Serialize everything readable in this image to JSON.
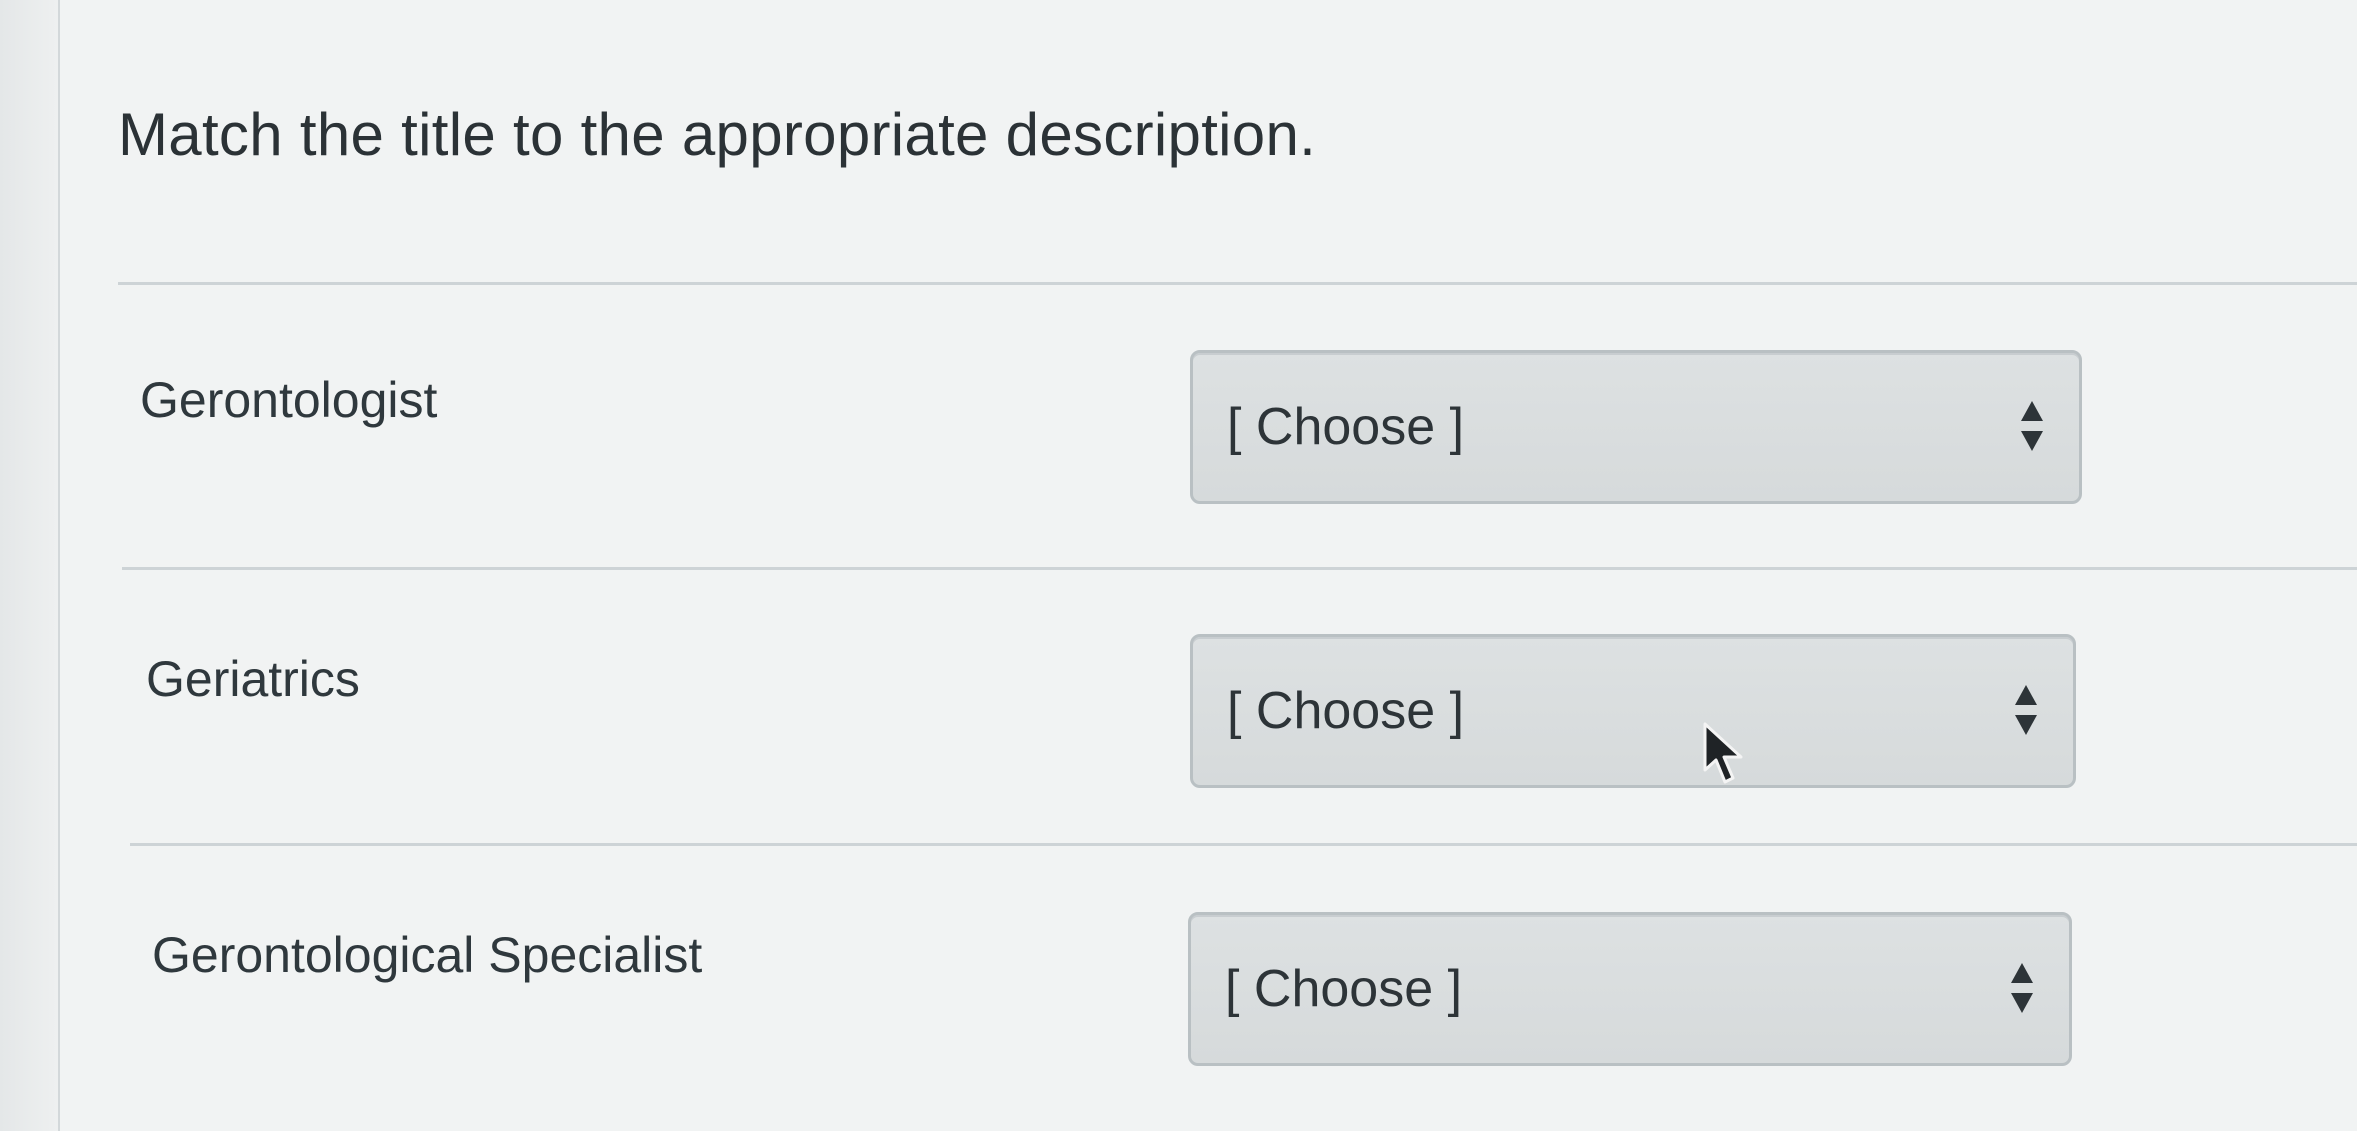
{
  "question": {
    "prompt": "Match the title to the appropriate description."
  },
  "answers": [
    {
      "term": "Gerontologist",
      "selected": "[ Choose ]"
    },
    {
      "term": "Geriatrics",
      "selected": "[ Choose ]"
    },
    {
      "term": "Gerontological Specialist",
      "selected": "[ Choose ]"
    }
  ],
  "icons": {
    "select_arrow": "up-down-chevron-icon",
    "pointer": "mouse-cursor-icon"
  },
  "colors": {
    "text": "#2d3b45",
    "select_bg": "#d9dddf",
    "select_border": "#b9c0c3",
    "divider": "#cdd3d6"
  }
}
